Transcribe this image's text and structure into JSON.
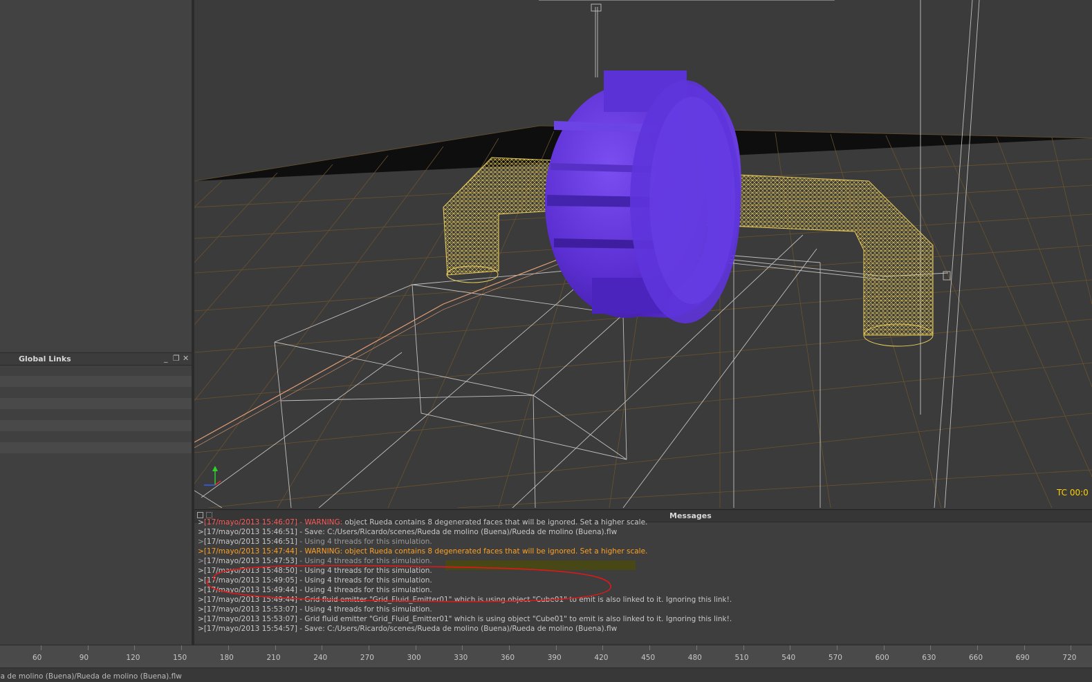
{
  "global_links": {
    "title": "Global Links",
    "minimize": "_",
    "restore": "❐",
    "close": "✕",
    "row_count": 8
  },
  "viewport": {
    "timecode": "TC 00:0",
    "objects": [
      "Rueda",
      "Cube01",
      "Grid_Fluid_Emitter01"
    ],
    "colors": {
      "wheel": "#5a2ed0",
      "pipe": "#e8cc5a",
      "grid": "#7a5a2a",
      "wire": "#d8d8d8"
    }
  },
  "messages": {
    "title": "Messages",
    "entries": [
      {
        "ts": "[17/mayo/2013 15:46:07]",
        "level": "WARNING:",
        "text": " object Rueda contains 8 degenerated faces that will be ignored. Set a higher scale.",
        "kind": "warn"
      },
      {
        "ts": "[17/mayo/2013 15:46:51]",
        "level": "",
        "text": " - Save: C:/Users/Ricardo/scenes/Rueda de molino (Buena)/Rueda de molino (Buena).flw",
        "kind": "info"
      },
      {
        "ts": "[17/mayo/2013 15:46:51]",
        "level": "",
        "text": " - Using 4 threads for this simulation.",
        "kind": "dim"
      },
      {
        "ts": "[17/mayo/2013 15:47:44]",
        "level": "WARNING:",
        "text": " object Rueda contains 8 degenerated faces that will be ignored. Set a higher scale.",
        "kind": "warn-hl"
      },
      {
        "ts": "[17/mayo/2013 15:47:53]",
        "level": "",
        "text": " - Using 4 threads for this simulation.",
        "kind": "dim"
      },
      {
        "ts": "[17/mayo/2013 15:48:50]",
        "level": "",
        "text": " - Using 4 threads for this simulation.",
        "kind": "info"
      },
      {
        "ts": "[17/mayo/2013 15:49:05]",
        "level": "",
        "text": " - Using 4 threads for this simulation.",
        "kind": "info"
      },
      {
        "ts": "[17/mayo/2013 15:49:44]",
        "level": "",
        "text": " - Using 4 threads for this simulation.",
        "kind": "info"
      },
      {
        "ts": "[17/mayo/2013 15:49:44]",
        "level": "",
        "text": " - Grid fluid emitter \"Grid_Fluid_Emitter01\" which is using object \"Cube01\" to emit is also linked to it. Ignoring this link!.",
        "kind": "info"
      },
      {
        "ts": "[17/mayo/2013 15:53:07]",
        "level": "",
        "text": " - Using 4 threads for this simulation.",
        "kind": "info"
      },
      {
        "ts": "[17/mayo/2013 15:53:07]",
        "level": "",
        "text": " - Grid fluid emitter \"Grid_Fluid_Emitter01\" which is using object \"Cube01\" to emit is also linked to it. Ignoring this link!.",
        "kind": "info"
      },
      {
        "ts": "[17/mayo/2013 15:54:57]",
        "level": "",
        "text": " - Save: C:/Users/Ricardo/scenes/Rueda de molino (Buena)/Rueda de molino (Buena).flw",
        "kind": "info"
      }
    ],
    "annotation_color": "#e01818"
  },
  "timeline": {
    "labels": [
      "60",
      "90",
      "120",
      "150",
      "180",
      "210",
      "240",
      "270",
      "300",
      "330",
      "360",
      "390",
      "420",
      "450",
      "480",
      "510",
      "540",
      "570",
      "600",
      "630",
      "660",
      "690",
      "720"
    ]
  },
  "status": {
    "text": "da de molino (Buena)/Rueda de molino (Buena).flw"
  }
}
